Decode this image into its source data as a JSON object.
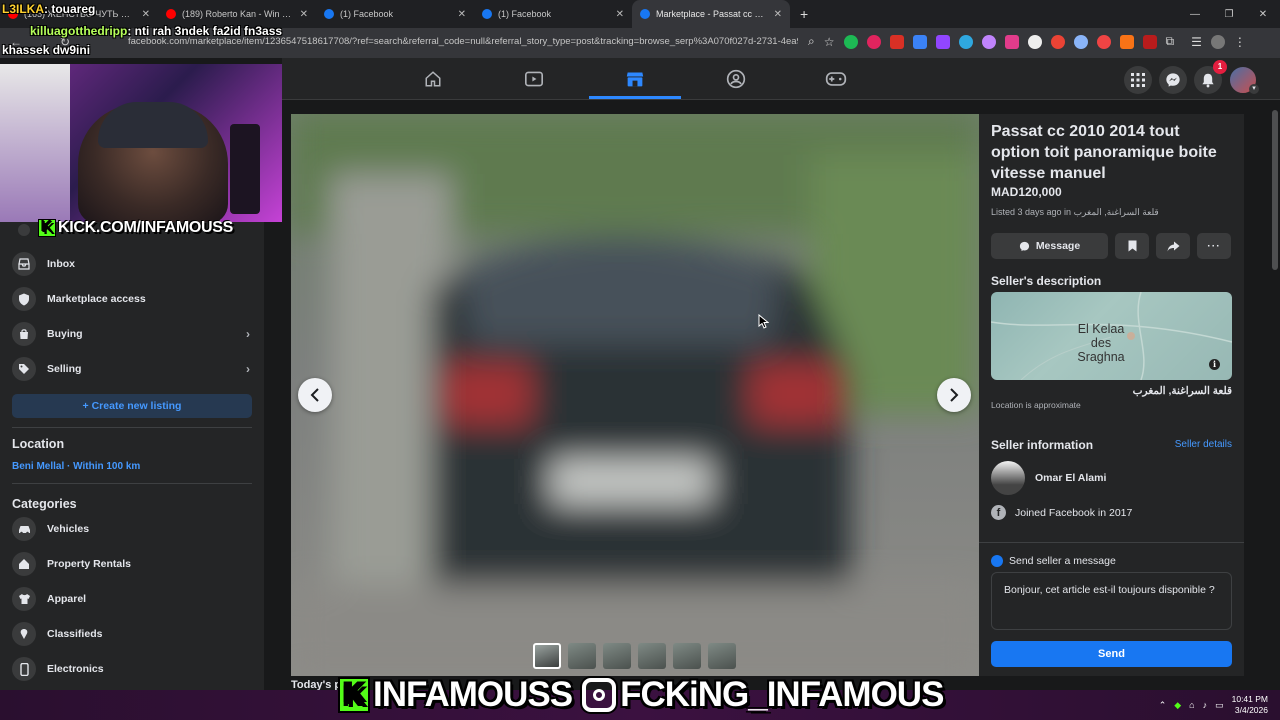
{
  "browser": {
    "tabs": [
      {
        "title": "(165) ЖЕНСТВО ЧУТЬ НЕ РАЗБ...",
        "favicon_color": "#ff0000",
        "active": false
      },
      {
        "title": "(189) Roberto Kan - Win (slowe...",
        "favicon_color": "#ff0000",
        "active": false
      },
      {
        "title": "(1) Facebook",
        "favicon_color": "#1877f2",
        "active": false
      },
      {
        "title": "(1) Facebook",
        "favicon_color": "#1877f2",
        "active": false
      },
      {
        "title": "Marketplace - Passat cc 2010 20...",
        "favicon_color": "#1877f2",
        "active": true
      }
    ],
    "new_tab": "+",
    "url": "facebook.com/marketplace/item/1236547518617708/?ref=search&referral_code=null&referral_story_type=post&tracking=browse_serp%3A070f027d-2731-4ea9..."
  },
  "facebook_nav": {
    "active_tab": "marketplace",
    "notification_count": "1"
  },
  "sidebar": {
    "items_top": [
      {
        "label": "Inbox",
        "icon": "inbox-icon"
      },
      {
        "label": "Marketplace access",
        "icon": "shield-icon"
      },
      {
        "label": "Buying",
        "icon": "bag-icon",
        "chevron": true
      },
      {
        "label": "Selling",
        "icon": "tag-icon",
        "chevron": true
      }
    ],
    "create_listing": "+ Create new listing",
    "location_heading": "Location",
    "location_value": "Beni Mellal · Within 100 km",
    "categories_heading": "Categories",
    "categories": [
      {
        "label": "Vehicles",
        "icon": "car-icon"
      },
      {
        "label": "Property Rentals",
        "icon": "house-icon"
      },
      {
        "label": "Apparel",
        "icon": "shirt-icon"
      },
      {
        "label": "Classifieds",
        "icon": "classifieds-icon"
      },
      {
        "label": "Electronics",
        "icon": "phone-icon"
      }
    ]
  },
  "listing": {
    "title": "Passat cc 2010 2014 tout option toit panoramique boite vitesse manuel",
    "price": "MAD120,000",
    "listed": "Listed 3 days ago in قلعة السراغنة, المغرب",
    "message_button": "Message",
    "sellers_description_heading": "Seller's description",
    "map_label_line1": "El Kelaa",
    "map_label_line2": "des",
    "map_label_line3": "Sraghna",
    "city_ar": "قلعة السراغنة, المغرب",
    "location_note": "Location is approximate",
    "seller_info_heading": "Seller information",
    "seller_details_link": "Seller details",
    "seller_name": "Omar El Alami",
    "joined": "Joined Facebook in 2017",
    "send_message_label": "Send seller a message",
    "message_text": "Bonjour, cet article est-il toujours disponible ?",
    "send_button": "Send",
    "thumbnail_count": 6,
    "active_thumbnail": 1
  },
  "below_photo": {
    "today": "Today's picks"
  },
  "stream_overlay": {
    "chat": [
      {
        "user": "L3ILKA",
        "msg": ": touareg"
      },
      {
        "user": "killuagotthedripp",
        "msg": ": nti rah 3ndek fa2id fn3ass"
      },
      {
        "user": "",
        "msg": "khassek dw9ini"
      }
    ],
    "kick_url": "KICK.COM/INFAMOUSS",
    "banner_kick": "INFAMOUSS",
    "banner_ig": "FCKiNG_INFAMOUS",
    "kick_letter": "K"
  },
  "taskbar": {
    "time": "10:41 PM",
    "date": "3/4/2026"
  },
  "colors": {
    "fb_blue": "#1877f2",
    "link_blue": "#4599ff",
    "panel_bg": "#242526",
    "kick_green": "#53fc18"
  }
}
